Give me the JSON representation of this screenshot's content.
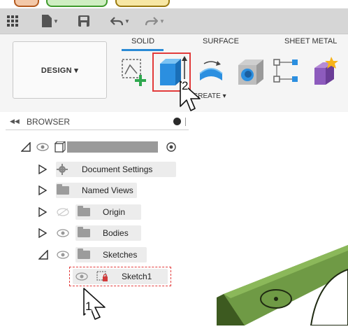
{
  "ribbon": {
    "design_label": "DESIGN ▾",
    "tabs": [
      "SOLID",
      "SURFACE",
      "SHEET METAL"
    ],
    "create_label": "CREATE ▾"
  },
  "browser": {
    "title": "BROWSER",
    "items": [
      {
        "label": "Document Settings"
      },
      {
        "label": "Named Views"
      },
      {
        "label": "Origin"
      },
      {
        "label": "Bodies"
      },
      {
        "label": "Sketches"
      },
      {
        "label": "Sketch1"
      }
    ]
  },
  "annotations": {
    "callout_1": "1",
    "callout_2": "2"
  },
  "colors": {
    "accent": "#2a8ad5",
    "highlight_red": "#e23b3b",
    "model_green": "#6f9a45"
  }
}
